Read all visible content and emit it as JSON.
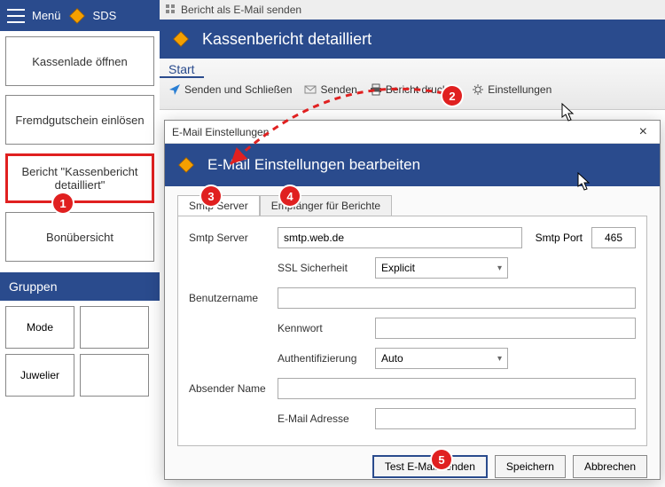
{
  "menu": {
    "label": "Menü",
    "sds_label": "SDS"
  },
  "tiles": {
    "t1": "Kassenlade öffnen",
    "t2": "Fremdgutschein einlösen",
    "t3": "Bericht \"Kassenbericht detailliert\"",
    "t4": "Bonübersicht"
  },
  "groups": {
    "header": "Gruppen",
    "g1": "Mode",
    "g2": "Juwelier"
  },
  "report": {
    "window_title": "Bericht als E-Mail senden",
    "banner": "Kassenbericht detailliert",
    "start": "Start",
    "a_send_close": "Senden und Schließen",
    "a_send": "Senden",
    "a_print": "Bericht drucken",
    "a_settings": "Einstellungen"
  },
  "dialog": {
    "titlebar": "E-Mail Einstellungen",
    "banner": "E-Mail Einstellungen bearbeiten",
    "tab_smtp": "Smtp Server",
    "tab_recipients": "Empfänger für Berichte",
    "lbl_server": "Smtp Server",
    "val_server": "smtp.web.de",
    "lbl_port": "Smtp Port",
    "val_port": "465",
    "lbl_ssl": "SSL Sicherheit",
    "val_ssl": "Explicit",
    "lbl_user": "Benutzername",
    "lbl_pass": "Kennwort",
    "lbl_auth": "Authentifizierung",
    "val_auth": "Auto",
    "lbl_sender": "Absender Name",
    "lbl_email": "E-Mail Adresse",
    "btn_test": "Test E-Mail senden",
    "btn_save": "Speichern",
    "btn_cancel": "Abbrechen"
  },
  "annotations": {
    "b1": "1",
    "b2": "2",
    "b3": "3",
    "b4": "4",
    "b5": "5"
  }
}
